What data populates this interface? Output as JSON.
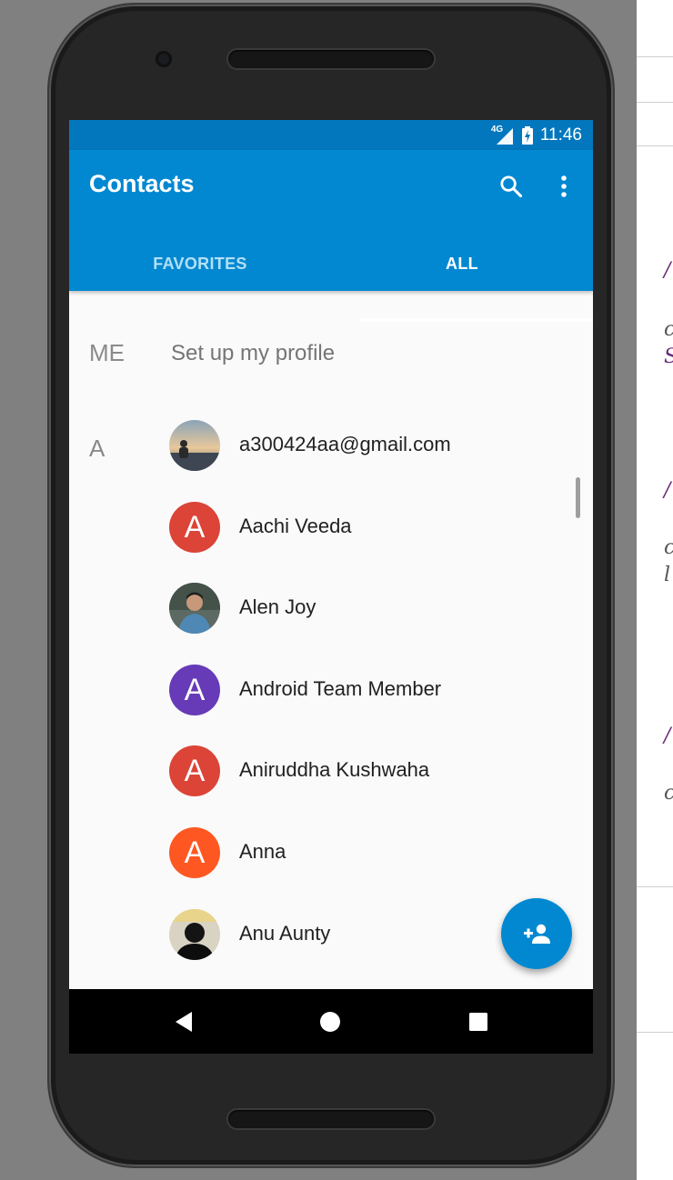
{
  "status_bar": {
    "network_label": "4G",
    "time": "11:46"
  },
  "app_bar": {
    "title": "Contacts",
    "search_icon": "search-icon",
    "more_icon": "more-vert-icon"
  },
  "tabs": [
    {
      "label": "FAVORITES",
      "selected": false
    },
    {
      "label": "ALL",
      "selected": true
    }
  ],
  "me_section": {
    "letter": "ME",
    "text": "Set up my profile"
  },
  "section_a": {
    "letter": "A"
  },
  "contacts": [
    {
      "name": "a300424aa@gmail.com",
      "avatar_type": "photo",
      "avatar_letter": "",
      "avatar_color": "#6b8fa8"
    },
    {
      "name": "Aachi Veeda",
      "avatar_type": "letter",
      "avatar_letter": "A",
      "avatar_color": "#db4437"
    },
    {
      "name": "Alen Joy",
      "avatar_type": "photo",
      "avatar_letter": "",
      "avatar_color": "#4a5a55"
    },
    {
      "name": "Android Team Member",
      "avatar_type": "letter",
      "avatar_letter": "A",
      "avatar_color": "#673ab7"
    },
    {
      "name": "Aniruddha Kushwaha",
      "avatar_type": "letter",
      "avatar_letter": "A",
      "avatar_color": "#db4437"
    },
    {
      "name": "Anna",
      "avatar_type": "letter",
      "avatar_letter": "A",
      "avatar_color": "#ff5722"
    },
    {
      "name": "Anu Aunty",
      "avatar_type": "photo",
      "avatar_letter": "",
      "avatar_color": "#3a3a3a"
    }
  ],
  "fab": {
    "icon": "add-contact-icon"
  },
  "nav_bar": {
    "back_icon": "back-icon",
    "home_icon": "home-icon",
    "recents_icon": "recents-icon"
  },
  "colors": {
    "primary": "#0288d1",
    "primary_dark": "#0277bd",
    "background": "#fafafa"
  }
}
